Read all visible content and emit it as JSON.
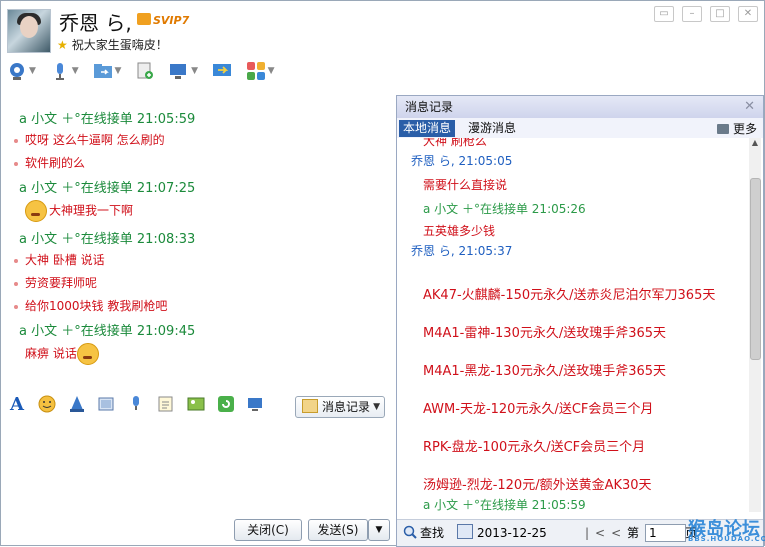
{
  "header": {
    "nickname": "乔恩 ら,",
    "vip_badge": "SVIP7",
    "signature": "祝大家生蛋嗨皮！"
  },
  "toolbar": {
    "icons": [
      "video-call-icon",
      "voice-call-icon",
      "file-transfer-icon",
      "sms-icon",
      "remote-desktop-icon",
      "share-screen-icon",
      "apps-icon"
    ]
  },
  "chat": {
    "messages": [
      {
        "head": "a 小文 ＋°在线接单  21:05:59",
        "lines": [
          "哎呀  这么牛逼啊     怎么刷的",
          "软件刷的么"
        ]
      },
      {
        "head": "a 小文 ＋°在线接单  21:07:25",
        "lines": [
          "大神理我一下啊"
        ]
      },
      {
        "head": "a 小文 ＋°在线接单  21:08:33",
        "lines": [
          "大神   卧槽    说话",
          "劳资要拜师呢",
          "给你1000块钱   教我刷枪吧"
        ]
      },
      {
        "head": "a 小文 ＋°在线接单  21:09:45",
        "lines": [
          "麻痹 说话"
        ]
      }
    ]
  },
  "format_bar": {
    "history_button": "消息记录"
  },
  "buttons": {
    "close": "关闭(C)",
    "send": "发送(S)"
  },
  "history": {
    "title": "消息记录",
    "tab_local": "本地消息",
    "tab_roaming": "漫游消息",
    "more": "更多",
    "entries": [
      {
        "text": "大神   刷枪么",
        "style": "red"
      },
      {
        "text": "乔恩 ら,  21:05:05",
        "style": "blue"
      },
      {
        "text": "需要什么直接说",
        "style": "red"
      },
      {
        "text": "a 小文 ＋°在线接单  21:05:26",
        "style": "green"
      },
      {
        "text": "五英雄多少钱",
        "style": "red"
      },
      {
        "text": "乔恩 ら,  21:05:37",
        "style": "blue"
      },
      {
        "text": "AK47-火麒麟-150元永久/送赤炎尼泊尔军刀365天",
        "style": "red-big"
      },
      {
        "text": "M4A1-雷神-130元永久/送玫瑰手斧365天",
        "style": "red-big"
      },
      {
        "text": "M4A1-黑龙-130元永久/送玫瑰手斧365天",
        "style": "red-big"
      },
      {
        "text": "AWM-天龙-120元永久/送CF会员三个月",
        "style": "red-big"
      },
      {
        "text": "RPK-盘龙-100元永久/送CF会员三个月",
        "style": "red-big"
      },
      {
        "text": "汤姆逊-烈龙-120元/额外送黄金AK30天",
        "style": "red-big"
      },
      {
        "text": "a 小文 ＋°在线接单  21:05:59",
        "style": "green"
      }
    ],
    "footer": {
      "search": "查找",
      "date": "2013-12-25",
      "page_label": "第",
      "page_value": "1",
      "page_suffix": "页"
    }
  },
  "watermark": {
    "text": "猴岛论坛",
    "sub": "BBS.HOUDAO.COM"
  }
}
